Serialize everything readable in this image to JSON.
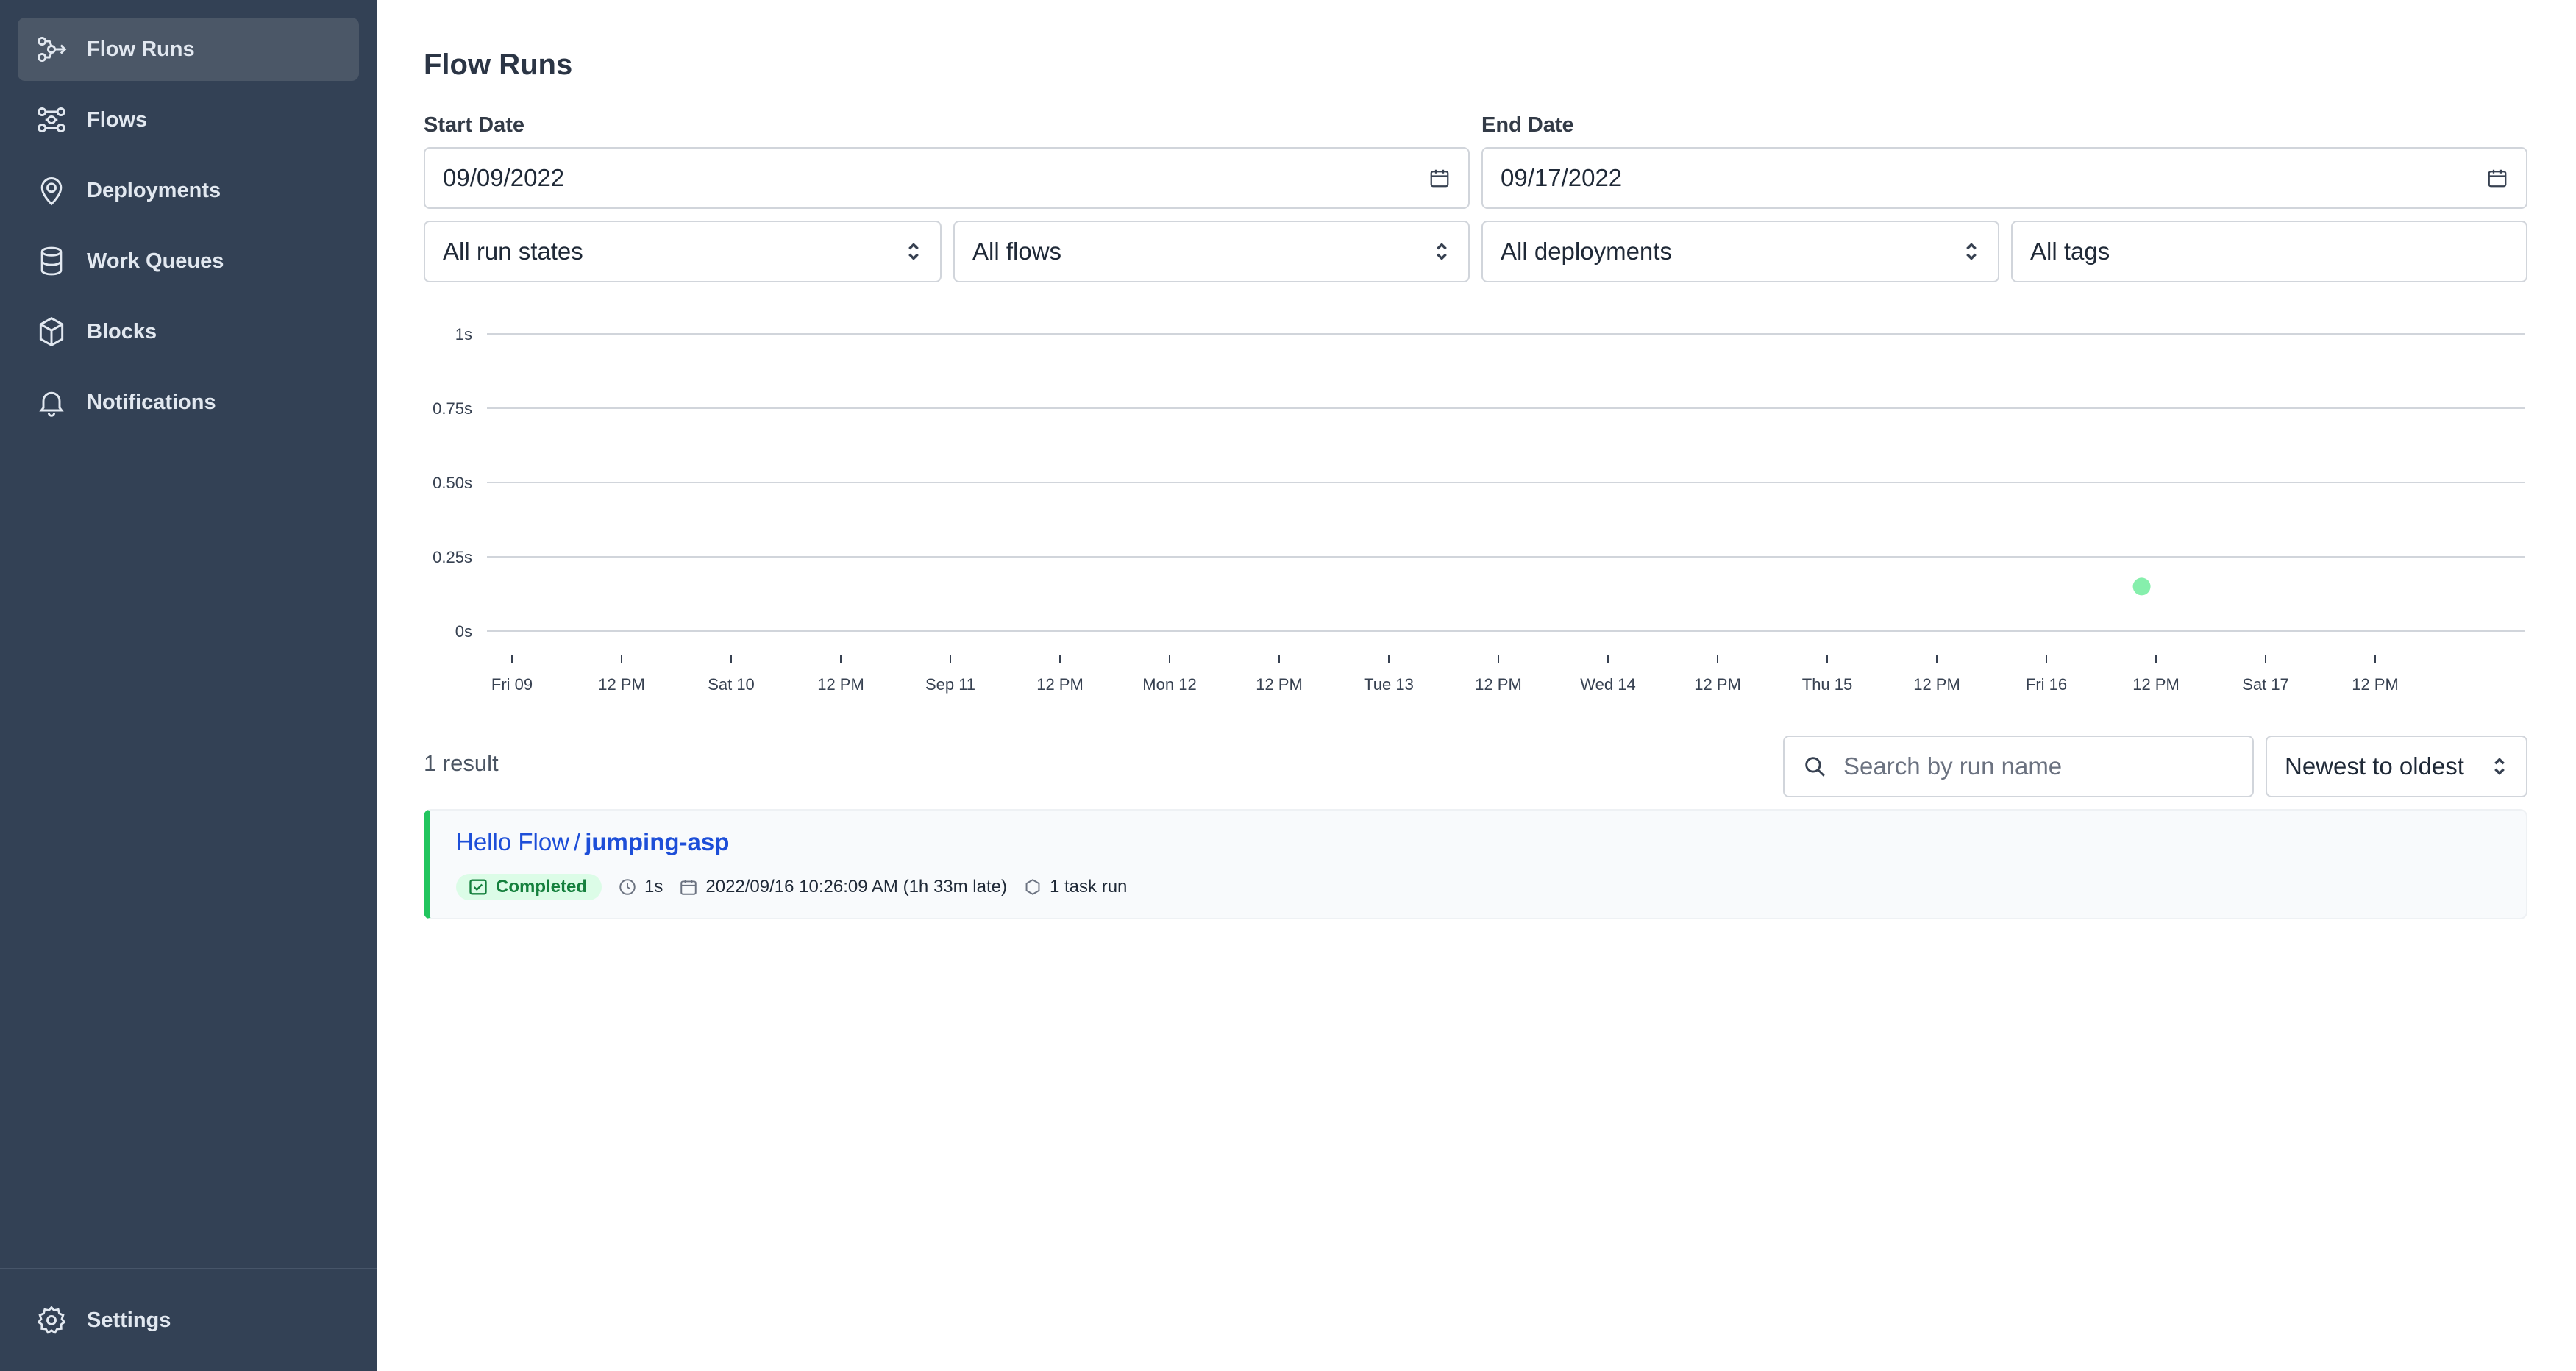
{
  "sidebar": {
    "items": [
      {
        "label": "Flow Runs",
        "icon": "flow-runs-icon",
        "active": true
      },
      {
        "label": "Flows",
        "icon": "flows-icon",
        "active": false
      },
      {
        "label": "Deployments",
        "icon": "map-pin-icon",
        "active": false
      },
      {
        "label": "Work Queues",
        "icon": "database-icon",
        "active": false
      },
      {
        "label": "Blocks",
        "icon": "cube-icon",
        "active": false
      },
      {
        "label": "Notifications",
        "icon": "bell-icon",
        "active": false
      }
    ],
    "footer": {
      "label": "Settings",
      "icon": "gear-icon"
    }
  },
  "page": {
    "title": "Flow Runs"
  },
  "filters": {
    "start_date": {
      "label": "Start Date",
      "value": "09/09/2022"
    },
    "end_date": {
      "label": "End Date",
      "value": "09/17/2022"
    },
    "run_states": "All run states",
    "flows": "All flows",
    "deployments": "All deployments",
    "tags": "All tags"
  },
  "chart_data": {
    "type": "scatter",
    "y_ticks": [
      "1s",
      "0.75s",
      "0.50s",
      "0.25s",
      "0s"
    ],
    "x_ticks": [
      "Fri 09",
      "12 PM",
      "Sat 10",
      "12 PM",
      "Sep 11",
      "12 PM",
      "Mon 12",
      "12 PM",
      "Tue 13",
      "12 PM",
      "Wed 14",
      "12 PM",
      "Thu 15",
      "12 PM",
      "Fri 16",
      "12 PM",
      "Sat 17",
      "12 PM"
    ],
    "ylim": [
      0,
      1
    ],
    "points": [
      {
        "x": "2022-09-16 10:26:09",
        "y": 0.15,
        "state": "Completed"
      }
    ],
    "point_color": "#86efac",
    "grid": true
  },
  "results": {
    "count_label": "1 result",
    "search_placeholder": "Search by run name",
    "sort": "Newest to oldest"
  },
  "runs": [
    {
      "flow_name": "Hello Flow",
      "separator": "/",
      "run_name": "jumping-asp",
      "state": "Completed",
      "duration": "1s",
      "start_time": "2022/09/16 10:26:09 AM (1h 33m late)",
      "task_runs": "1 task run"
    }
  ],
  "colors": {
    "sidebar": "#334155",
    "accent_link": "#1d4ed8",
    "completed": "#22c55e"
  }
}
